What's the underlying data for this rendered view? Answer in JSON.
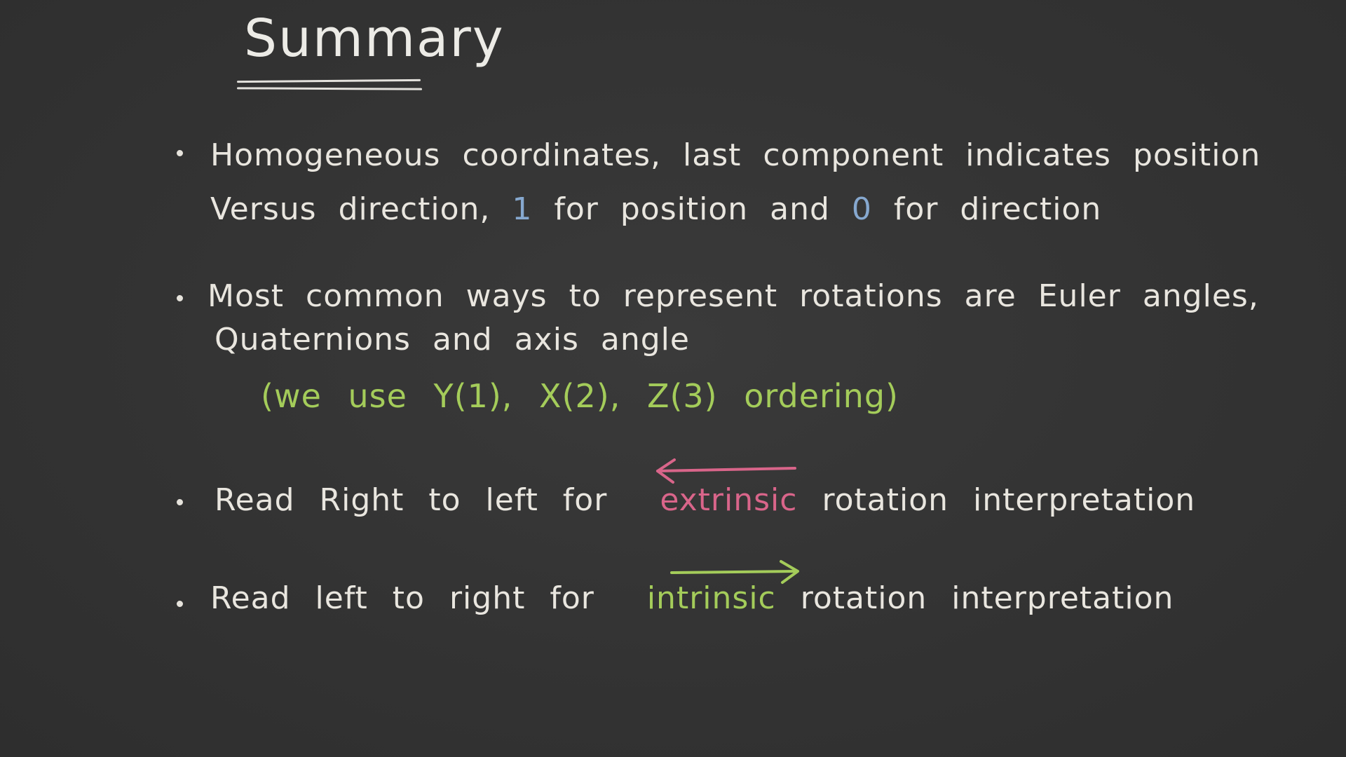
{
  "title": "Summary",
  "bullets": [
    {
      "line1": "Homogeneous coordinates, last component indicates position",
      "line2_a": "Versus direction,",
      "line2_one": "1",
      "line2_b": "for position and",
      "line2_zero": "0",
      "line2_c": "for direction"
    },
    {
      "line1": "Most common ways to represent rotations are Euler angles,",
      "line2": "Quaternions and axis angle",
      "note": "(we use Y(1), X(2), Z(3) ordering)"
    },
    {
      "prefix": "Read Right to left for",
      "keyword": "extrinsic",
      "suffix": "rotation interpretation"
    },
    {
      "prefix": "Read left to right for",
      "keyword": "intrinsic",
      "suffix": "rotation interpretation"
    }
  ],
  "colors": {
    "board": "#333333",
    "chalk": "#e9e6df",
    "blue": "#86a8cf",
    "green": "#a4cc5a",
    "pink": "#d9658a"
  }
}
